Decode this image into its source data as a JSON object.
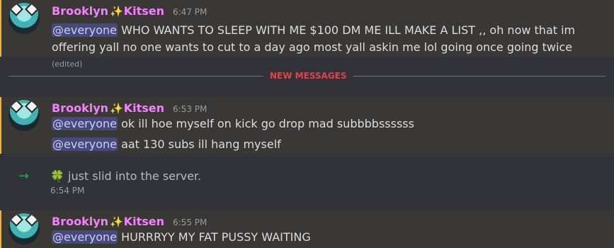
{
  "messages": [
    {
      "username": "Brooklyn",
      "sparkle": "✨",
      "username_suffix": "Kitsen",
      "time": "6:47 PM",
      "mention": "@everyone",
      "text_line1": " WHO WANTS TO SLEEP WITH ME $100 DM ME ILL MAKE A LIST ,, oh now that im",
      "text_line2": "offering yall no one wants to cut to a day ago most yall askin me lol going once going twice",
      "edited": "(edited)"
    },
    {
      "username": "Brooklyn",
      "sparkle": "✨",
      "username_suffix": "Kitsen",
      "time": "6:53 PM",
      "line1_mention": "@everyone",
      "line1_text": " ok ill hoe myself on kick go drop mad subbbbssssss",
      "line2_mention": "@everyone",
      "line2_text": " aat 130 subs ill hang myself"
    },
    {
      "username": "Brooklyn",
      "sparkle": "✨",
      "username_suffix": "Kitsen",
      "time": "6:55 PM",
      "mention": "@everyone",
      "text": " HURRRYY MY FAT PUSSY WAITING"
    }
  ],
  "divider": {
    "label": "NEW MESSAGES"
  },
  "join": {
    "icon": "arrow-right-icon",
    "text": "🍀 just slid into the server.",
    "time": "6:54 PM"
  },
  "colors": {
    "background": "#313338",
    "highlight": "#3a3834",
    "highlight_border": "#f0b232",
    "username": "#f47fff",
    "mention_bg": "#464a7a",
    "divider": "#e0434b",
    "join_arrow": "#23a55a"
  }
}
